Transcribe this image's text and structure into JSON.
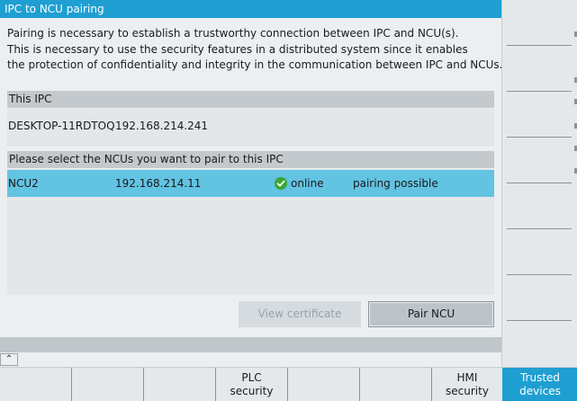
{
  "dialog": {
    "title": "IPC to NCU pairing",
    "intro": [
      "Pairing is necessary to establish a trustworthy connection between IPC and NCU(s).",
      "This is necessary to use the security features in a distributed system since it enables",
      "the protection of confidentiality and integrity in the communication between IPC and NCUs."
    ],
    "this_ipc": {
      "header": "This IPC",
      "name": "DESKTOP-11RDTOQ",
      "ip": "192.168.214.241"
    },
    "ncu_section": {
      "header": "Please select the NCUs you want to pair to this IPC",
      "rows": [
        {
          "name": "NCU2",
          "ip": "192.168.214.11",
          "status": "online",
          "pairing": "pairing possible",
          "status_icon": "check-circle-icon"
        }
      ]
    },
    "buttons": {
      "view_certificate": "View certificate",
      "pair_ncu": "Pair NCU"
    }
  },
  "expand_glyph": "⌃",
  "softkeys": {
    "horizontal": [
      {
        "line1": "",
        "line2": ""
      },
      {
        "line1": "",
        "line2": ""
      },
      {
        "line1": "",
        "line2": ""
      },
      {
        "line1": "PLC",
        "line2": "security"
      },
      {
        "line1": "",
        "line2": ""
      },
      {
        "line1": "",
        "line2": ""
      },
      {
        "line1": "HMI",
        "line2": "security"
      },
      {
        "line1": "Trusted",
        "line2": "devices"
      }
    ]
  },
  "colors": {
    "accent": "#1f9fd1",
    "selected_row": "#63c3e2",
    "online_green": "#3aa635"
  }
}
